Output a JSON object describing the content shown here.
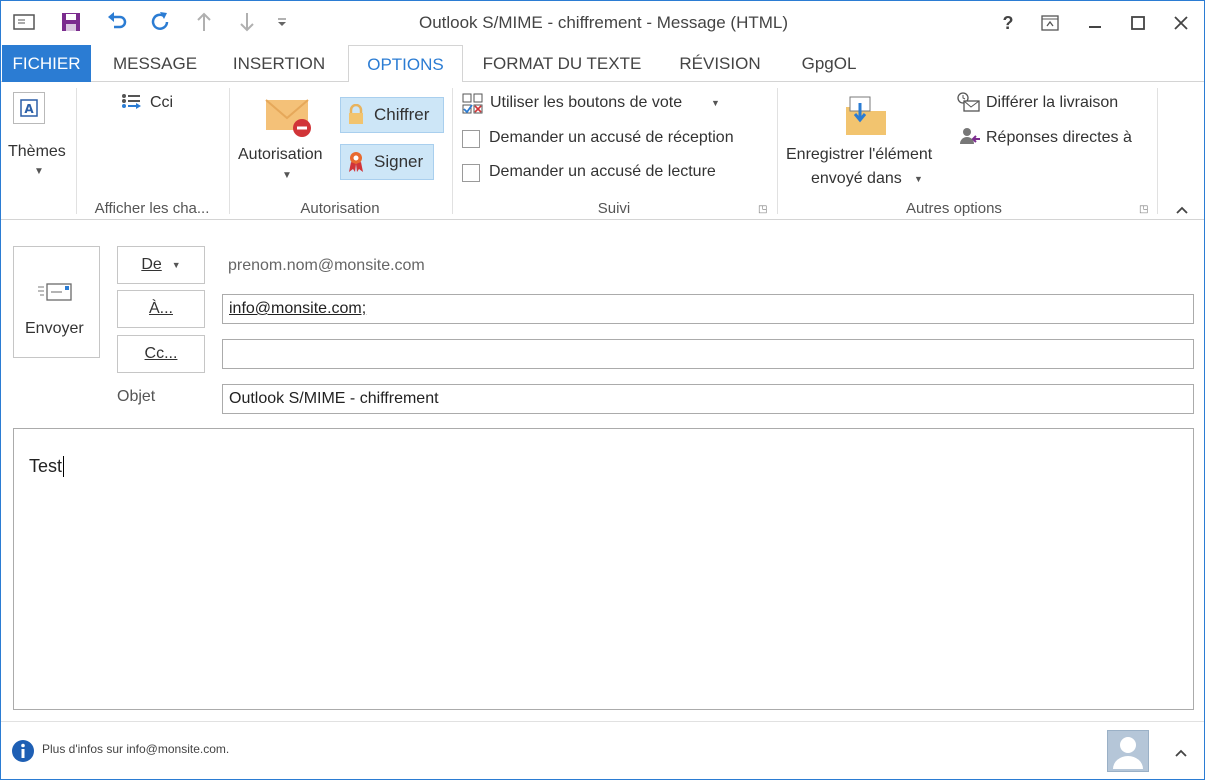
{
  "window": {
    "title": "Outlook S/MIME - chiffrement - Message (HTML)",
    "help": "?",
    "accent": "#2b7cd3"
  },
  "qat": {
    "icons": [
      "message-icon",
      "save-icon",
      "undo-icon",
      "redo-icon",
      "up-arrow-icon",
      "down-arrow-icon",
      "customize-icon"
    ]
  },
  "tabs": [
    {
      "label": "FICHIER"
    },
    {
      "label": "MESSAGE"
    },
    {
      "label": "INSERTION"
    },
    {
      "label": "OPTIONS"
    },
    {
      "label": "FORMAT DU TEXTE"
    },
    {
      "label": "RÉVISION"
    },
    {
      "label": "GpgOL"
    }
  ],
  "ribbon": {
    "themes_label": "Thèmes",
    "cci_label": "Cci",
    "show_fields_group": "Afficher les cha...",
    "autorisation_label": "Autorisation",
    "chiffrer_label": "Chiffrer",
    "signer_label": "Signer",
    "autorisation_group": "Autorisation",
    "vote_label": "Utiliser les boutons de vote",
    "delivery_receipt_label": "Demander un accusé de réception",
    "read_receipt_label": "Demander un accusé de lecture",
    "suivi_group": "Suivi",
    "save_item_line1": "Enregistrer l'élément",
    "save_item_line2": "envoyé dans",
    "delay_label": "Différer la livraison",
    "replies_label": "Réponses directes à",
    "other_group": "Autres options"
  },
  "compose": {
    "send_label": "Envoyer",
    "from_label": "De",
    "from_value": "prenom.nom@monsite.com",
    "to_label": "À...",
    "to_value": "info@monsite.com;",
    "cc_label": "Cc...",
    "cc_value": "",
    "subject_label": "Objet",
    "subject_value": "Outlook S/MIME - chiffrement",
    "body_text": "Test"
  },
  "status": {
    "info_text": "Plus d'infos sur info@monsite.com."
  }
}
